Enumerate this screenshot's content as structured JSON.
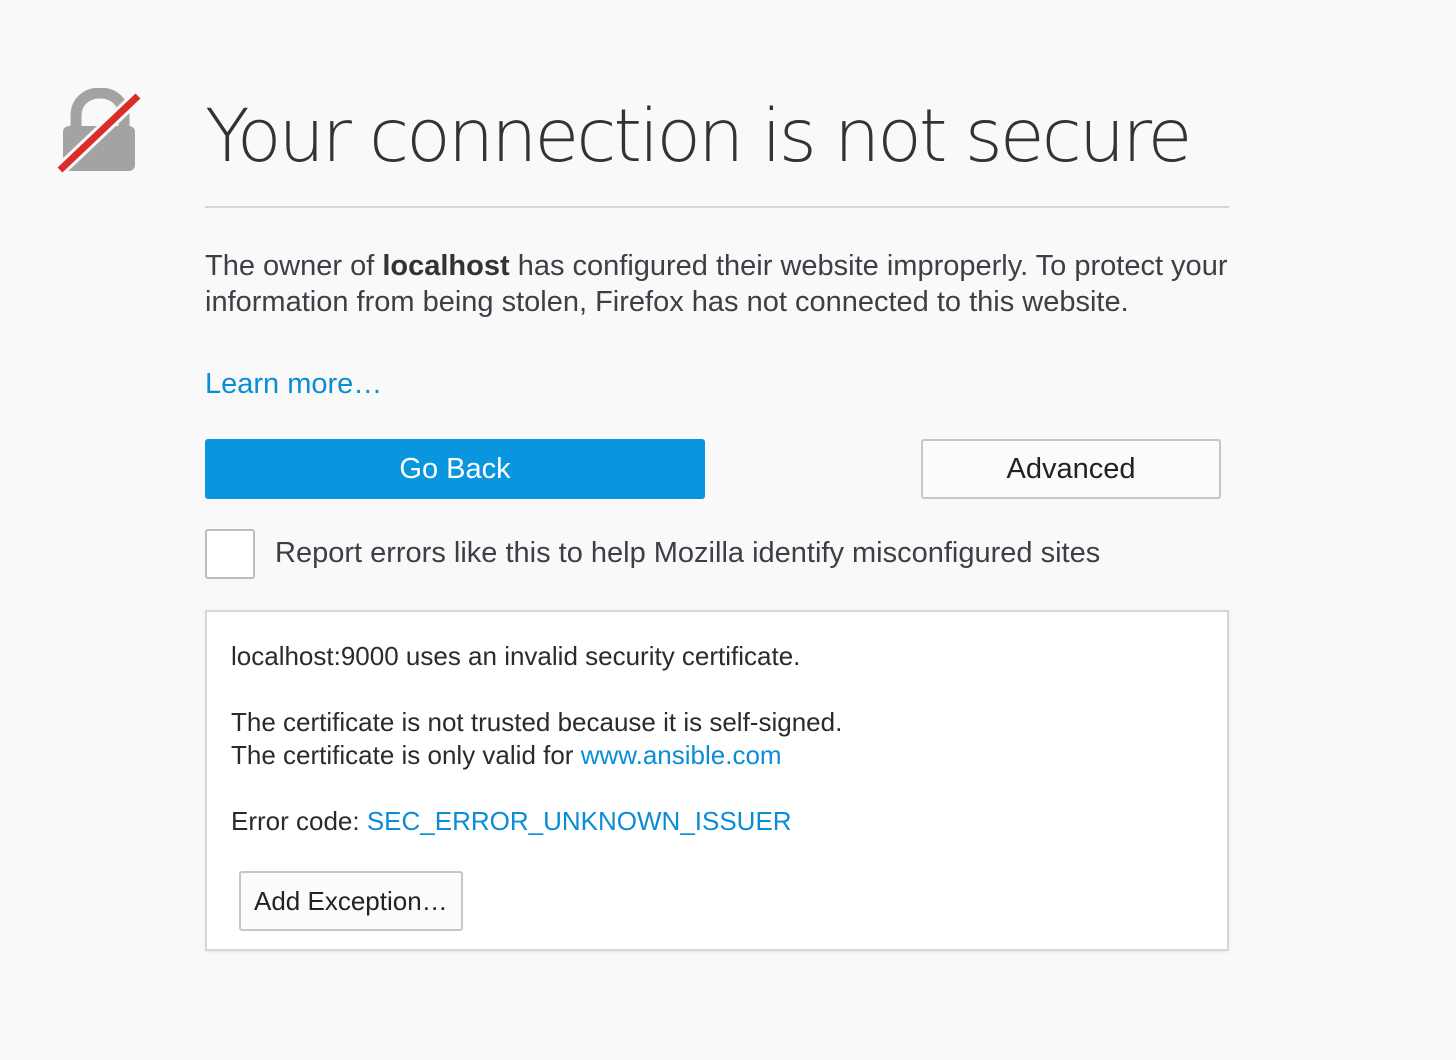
{
  "page": {
    "title": "Your connection is not secure",
    "description": {
      "prefix": "The owner of ",
      "host": "localhost",
      "suffix": " has configured their website improperly. To protect your information from being stolen, Firefox has not connected to this website."
    },
    "learn_more": "Learn more…",
    "go_back_label": "Go Back",
    "advanced_label": "Advanced",
    "report_label": "Report errors like this to help Mozilla identify misconfigured sites",
    "report_checked": false
  },
  "advanced": {
    "line1": "localhost:9000 uses an invalid security certificate.",
    "line2": "The certificate is not trusted because it is self-signed.",
    "line3_prefix": "The certificate is only valid for ",
    "line3_link": "www.ansible.com",
    "error_prefix": "Error code: ",
    "error_code": "SEC_ERROR_UNKNOWN_ISSUER",
    "add_exception_label": "Add Exception…"
  },
  "icons": {
    "lock": "broken-lock-icon"
  },
  "colors": {
    "primary": "#0996de",
    "link": "#0a8dd6",
    "lock_gray": "#a3a3a3",
    "slash_red": "#d92d2a",
    "background": "#f9f9fa"
  }
}
